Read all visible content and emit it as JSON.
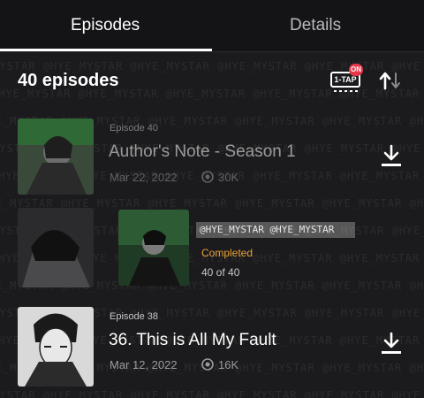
{
  "tabs": [
    {
      "label": "Episodes",
      "active": true
    },
    {
      "label": "Details",
      "active": false
    }
  ],
  "episode_count": "40 episodes",
  "toolbar": {
    "one_tap_label": "1-TAP",
    "one_tap_badge": "ON",
    "sort_icon": "sort-arrows-icon"
  },
  "watermark_text": "@HYE_MYSTAR",
  "episodes": [
    {
      "number": "Episode 40",
      "title": "Author's Note - Season 1",
      "date": "Mar 22, 2022",
      "views": "30K",
      "dimmed": true
    },
    {
      "number": "Episode 38",
      "title": "36. This is All My Fault",
      "date": "Mar 12, 2022",
      "views": "16K",
      "dimmed": false
    }
  ],
  "banner": {
    "overlay": "@HYE_MYSTAR @HYE_MYSTAR",
    "status": "Completed",
    "progress": "40 of 40"
  },
  "colors": {
    "background": "#1b1b1d",
    "status_orange": "#e8a136",
    "badge_red": "#e8374a"
  }
}
